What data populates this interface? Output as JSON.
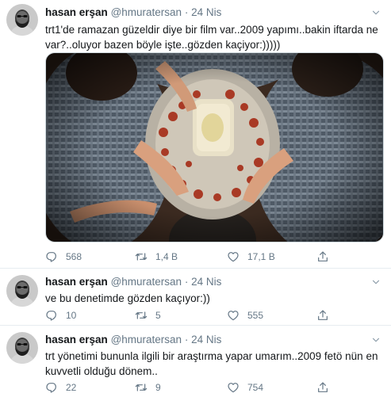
{
  "tweets": [
    {
      "name": "hasan erşan",
      "handle": "@hmuratersan",
      "dot": "·",
      "time": "24 Nis",
      "text": "trt1'de ramazan güzeldir diye bir film var..2009 yapımı..bakin iftarda ne var?..oluyor bazen böyle işte..gözden kaçiyor:)))))",
      "replies": "568",
      "retweets": "1,4 B",
      "likes": "17,1 B"
    },
    {
      "name": "hasan erşan",
      "handle": "@hmuratersan",
      "dot": "·",
      "time": "24 Nis",
      "text": "ve bu denetimde gözden kaçıyor:))",
      "replies": "10",
      "retweets": "5",
      "likes": "555"
    },
    {
      "name": "hasan erşan",
      "handle": "@hmuratersan",
      "dot": "·",
      "time": "24 Nis",
      "text": "trt yönetimi bununla ilgili bir araştırma yapar umarım..2009 fetö nün en kuvvetli olduğu dönem..",
      "replies": "22",
      "retweets": "9",
      "likes": "754"
    }
  ],
  "colors": {
    "text": "#14171a",
    "secondary": "#657786",
    "divider": "#e6ecf0"
  },
  "icons": [
    "avatar",
    "chevron-down-icon",
    "reply-icon",
    "retweet-icon",
    "like-icon",
    "share-icon"
  ]
}
